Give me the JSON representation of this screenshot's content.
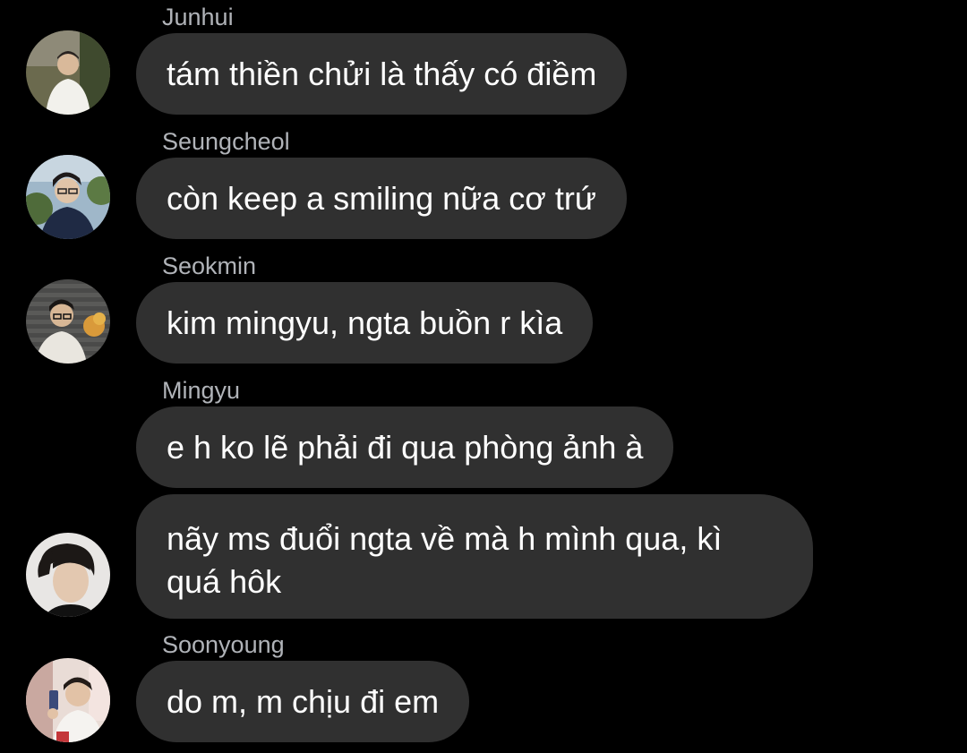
{
  "messages": [
    {
      "sender": "Junhui",
      "text": "tám thiền chửi là thấy có điềm"
    },
    {
      "sender": "Seungcheol",
      "text": "còn keep a smiling nữa cơ trứ"
    },
    {
      "sender": "Seokmin",
      "text": "kim mingyu, ngta buồn r kìa"
    },
    {
      "sender": "Mingyu",
      "text": "e h ko lẽ phải đi qua phòng ảnh à"
    },
    {
      "sender": "",
      "text": "nãy ms đuổi ngta về mà h mình qua, kì quá hôk"
    },
    {
      "sender": "Soonyoung",
      "text": "do m, m chịu đi em"
    }
  ],
  "colors": {
    "background": "#000000",
    "bubble": "#303030",
    "bubble_text": "#ffffff",
    "sender_name": "#b0b3b8"
  },
  "avatars": [
    "avatar-junhui",
    "avatar-seungcheol",
    "avatar-seokmin",
    "avatar-mingyu",
    "avatar-soonyoung"
  ]
}
